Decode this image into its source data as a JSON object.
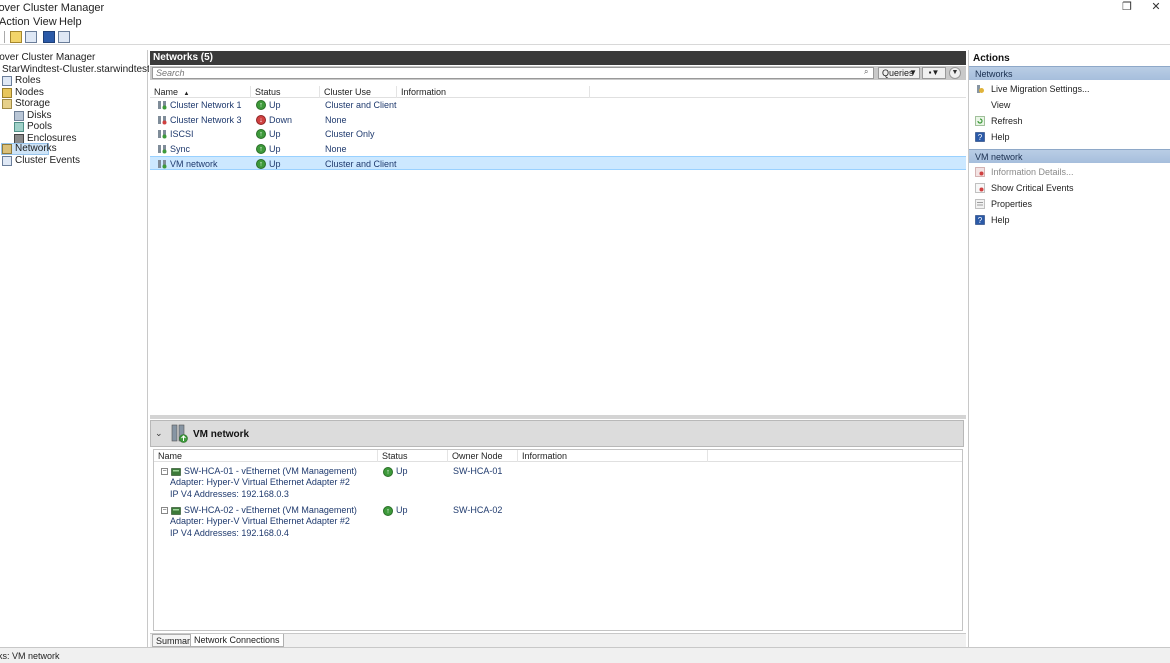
{
  "window": {
    "title": "lover Cluster Manager",
    "restore_glyph": "❐",
    "close_glyph": "✕"
  },
  "menu": [
    "Action",
    "View",
    "Help"
  ],
  "tree": {
    "items": [
      {
        "label": "lover Cluster Manager",
        "icon": "cluster-manager-icon"
      },
      {
        "label": "StarWindtest-Cluster.starwindtest.local",
        "icon": "none"
      },
      {
        "label": "Roles",
        "icon": "roles-icon"
      },
      {
        "label": "Nodes",
        "icon": "nodes-icon"
      },
      {
        "label": "Storage",
        "icon": "storage-icon"
      },
      {
        "label": "Disks",
        "icon": "disks-icon"
      },
      {
        "label": "Pools",
        "icon": "pools-icon"
      },
      {
        "label": "Enclosures",
        "icon": "enclosures-icon"
      },
      {
        "label": "Networks",
        "icon": "networks-icon",
        "selected": true
      },
      {
        "label": "Cluster Events",
        "icon": "cluster-events-icon"
      }
    ]
  },
  "center": {
    "header": "Networks (5)",
    "search_placeholder": "Search",
    "queries_label": "Queries",
    "columns": [
      "Name",
      "Status",
      "Cluster Use",
      "Information"
    ],
    "sort_indicator": "▲",
    "rows": [
      {
        "name": "Cluster Network 1",
        "status": "Up",
        "use": "Cluster and Client",
        "info": ""
      },
      {
        "name": "Cluster Network 3",
        "status": "Down",
        "use": "None",
        "info": ""
      },
      {
        "name": "ISCSI",
        "status": "Up",
        "use": "Cluster Only",
        "info": ""
      },
      {
        "name": "Sync",
        "status": "Up",
        "use": "None",
        "info": ""
      },
      {
        "name": "VM network",
        "status": "Up",
        "use": "Cluster and Client",
        "info": "",
        "selected": true
      }
    ]
  },
  "detail": {
    "title": "VM network",
    "columns": [
      "Name",
      "Status",
      "Owner Node",
      "Information"
    ],
    "connections": [
      {
        "name": "SW-HCA-01 - vEthernet (VM Management)",
        "adapter": "Adapter: Hyper-V Virtual Ethernet Adapter #2",
        "ip": "IP V4 Addresses: 192.168.0.3",
        "status": "Up",
        "owner": "SW-HCA-01"
      },
      {
        "name": "SW-HCA-02 - vEthernet (VM Management)",
        "adapter": "Adapter: Hyper-V Virtual Ethernet Adapter #2",
        "ip": "IP V4 Addresses: 192.168.0.4",
        "status": "Up",
        "owner": "SW-HCA-02"
      }
    ],
    "tabs": [
      "Summary",
      "Network Connections"
    ]
  },
  "actions": {
    "title": "Actions",
    "groups": [
      {
        "label": "Networks",
        "items": [
          {
            "label": "Live Migration Settings...",
            "icon": "live-migration-icon"
          },
          {
            "label": "View",
            "icon": "none"
          },
          {
            "label": "Refresh",
            "icon": "refresh-icon"
          },
          {
            "label": "Help",
            "icon": "help-icon"
          }
        ]
      },
      {
        "label": "VM network",
        "items": [
          {
            "label": "Information Details...",
            "icon": "information-details-icon",
            "disabled": true
          },
          {
            "label": "Show Critical Events",
            "icon": "critical-events-icon"
          },
          {
            "label": "Properties",
            "icon": "properties-icon"
          },
          {
            "label": "Help",
            "icon": "help-icon"
          }
        ]
      }
    ]
  },
  "statusbar": {
    "text": "ks:  VM network"
  },
  "colors": {
    "up": "#3d9a3a",
    "down": "#d04040",
    "selection": "#cce8ff",
    "action_group": "#b9cde5",
    "header_dark": "#3a3a3a"
  }
}
